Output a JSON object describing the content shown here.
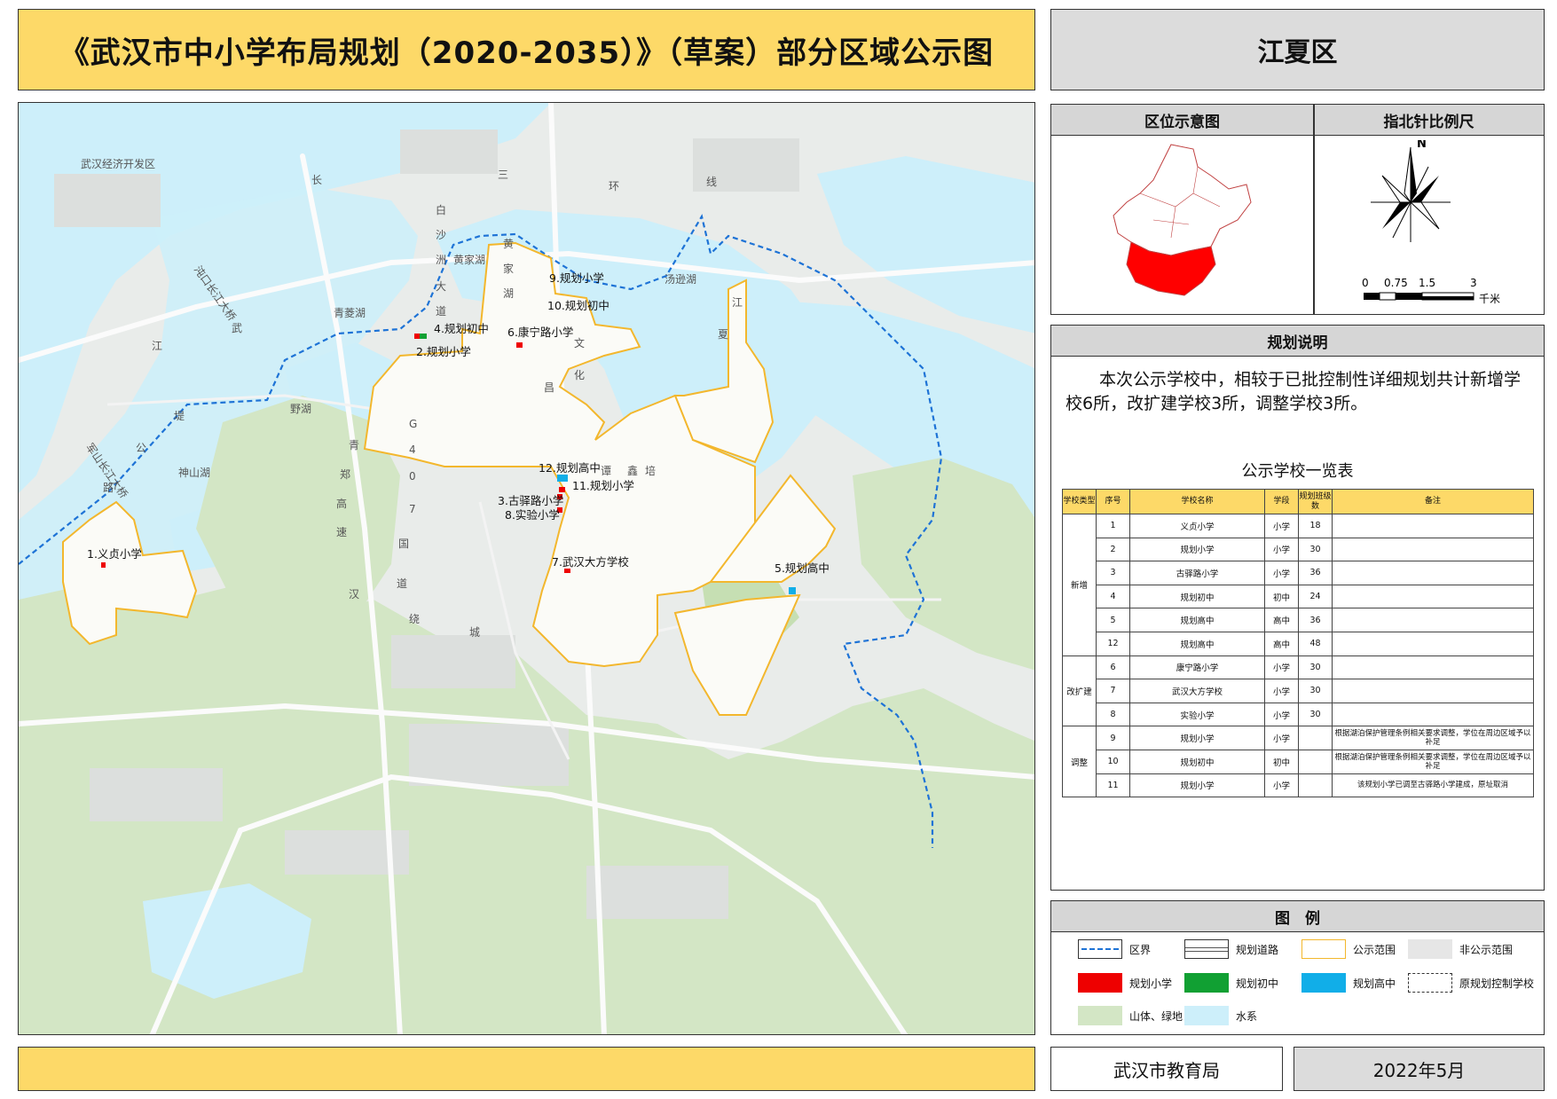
{
  "header": {
    "title": "《武汉市中小学布局规划（2020-2035）》（草案）部分区域公示图",
    "district": "江夏区"
  },
  "locator": {
    "title": "区位示意图"
  },
  "compass": {
    "title": "指北针比例尺",
    "north": "N",
    "scale_ticks": [
      "0",
      "0.75",
      "1.5",
      "3"
    ],
    "scale_unit": "千米"
  },
  "notes": {
    "title": "规划说明",
    "text": "本次公示学校中，相较于已批控制性详细规划共计新增学校6所，改扩建学校3所，调整学校3所。",
    "table_title": "公示学校一览表",
    "columns": [
      "学校类型",
      "序号",
      "学校名称",
      "学段",
      "规划班级数",
      "备注"
    ],
    "groups": [
      {
        "type": "新增",
        "rows": [
          {
            "no": "1",
            "name": "义贞小学",
            "stage": "小学",
            "classes": "18",
            "remark": ""
          },
          {
            "no": "2",
            "name": "规划小学",
            "stage": "小学",
            "classes": "30",
            "remark": ""
          },
          {
            "no": "3",
            "name": "古驿路小学",
            "stage": "小学",
            "classes": "36",
            "remark": ""
          },
          {
            "no": "4",
            "name": "规划初中",
            "stage": "初中",
            "classes": "24",
            "remark": ""
          },
          {
            "no": "5",
            "name": "规划高中",
            "stage": "高中",
            "classes": "36",
            "remark": ""
          },
          {
            "no": "12",
            "name": "规划高中",
            "stage": "高中",
            "classes": "48",
            "remark": ""
          }
        ]
      },
      {
        "type": "改扩建",
        "rows": [
          {
            "no": "6",
            "name": "康宁路小学",
            "stage": "小学",
            "classes": "30",
            "remark": ""
          },
          {
            "no": "7",
            "name": "武汉大方学校",
            "stage": "小学",
            "classes": "30",
            "remark": ""
          },
          {
            "no": "8",
            "name": "实验小学",
            "stage": "小学",
            "classes": "30",
            "remark": ""
          }
        ]
      },
      {
        "type": "调整",
        "rows": [
          {
            "no": "9",
            "name": "规划小学",
            "stage": "小学",
            "classes": "",
            "remark": "根据湖泊保护管理条例相关要求调整，学位在周边区域予以补足"
          },
          {
            "no": "10",
            "name": "规划初中",
            "stage": "初中",
            "classes": "",
            "remark": "根据湖泊保护管理条例相关要求调整，学位在周边区域予以补足"
          },
          {
            "no": "11",
            "name": "规划小学",
            "stage": "小学",
            "classes": "",
            "remark": "该规划小学已调至古驿路小学建成，原址取消"
          }
        ]
      }
    ]
  },
  "legend": {
    "title": "图　例",
    "items": [
      {
        "key": "district-boundary",
        "label": "区界"
      },
      {
        "key": "planned-road",
        "label": "规划道路"
      },
      {
        "key": "publicity-range",
        "label": "公示范围"
      },
      {
        "key": "non-publicity-range",
        "label": "非公示范围"
      },
      {
        "key": "planned-primary",
        "label": "规划小学",
        "color": "#ee0000"
      },
      {
        "key": "planned-middle",
        "label": "规划初中",
        "color": "#11a033"
      },
      {
        "key": "planned-high",
        "label": "规划高中",
        "color": "#11aee8"
      },
      {
        "key": "original-school",
        "label": "原规划控制学校"
      },
      {
        "key": "green",
        "label": "山体、绿地",
        "color": "#d3e6c5"
      },
      {
        "key": "water",
        "label": "水系",
        "color": "#cdeffa"
      }
    ]
  },
  "map": {
    "schools": [
      {
        "id": "1",
        "label": "1.义贞小学",
        "kind": "primary"
      },
      {
        "id": "2",
        "label": "2.规划小学",
        "kind": "primary"
      },
      {
        "id": "3",
        "label": "3.古驿路小学",
        "kind": "primary"
      },
      {
        "id": "4",
        "label": "4.规划初中",
        "kind": "middle"
      },
      {
        "id": "5",
        "label": "5.规划高中",
        "kind": "high"
      },
      {
        "id": "6",
        "label": "6.康宁路小学",
        "kind": "primary"
      },
      {
        "id": "7",
        "label": "7.武汉大方学校",
        "kind": "primary"
      },
      {
        "id": "8",
        "label": "8.实验小学",
        "kind": "primary"
      },
      {
        "id": "9",
        "label": "9.规划小学",
        "kind": "adjusted"
      },
      {
        "id": "10",
        "label": "10.规划初中",
        "kind": "adjusted"
      },
      {
        "id": "11",
        "label": "11.规划小学",
        "kind": "primary"
      },
      {
        "id": "12",
        "label": "12.规划高中",
        "kind": "high"
      }
    ],
    "place_labels": [
      "武汉经济开发区",
      "长",
      "三",
      "环",
      "线",
      "白",
      "沙",
      "洲",
      "大",
      "道",
      "黄",
      "家",
      "湖",
      "黄家湖",
      "汤逊湖",
      "青菱湖",
      "沌口长江大桥",
      "武",
      "江",
      "野湖",
      "堤",
      "公",
      "军山长江大桥",
      "神山湖",
      "路",
      "青",
      "郑",
      "高",
      "速",
      "国",
      "道",
      "汉",
      "绕",
      "城",
      "文",
      "化",
      "昌",
      "江",
      "夏",
      "谭",
      "鑫",
      "培",
      "G",
      "4",
      "0",
      "7"
    ]
  },
  "footer": {
    "org": "武汉市教育局",
    "date": "2022年5月"
  }
}
